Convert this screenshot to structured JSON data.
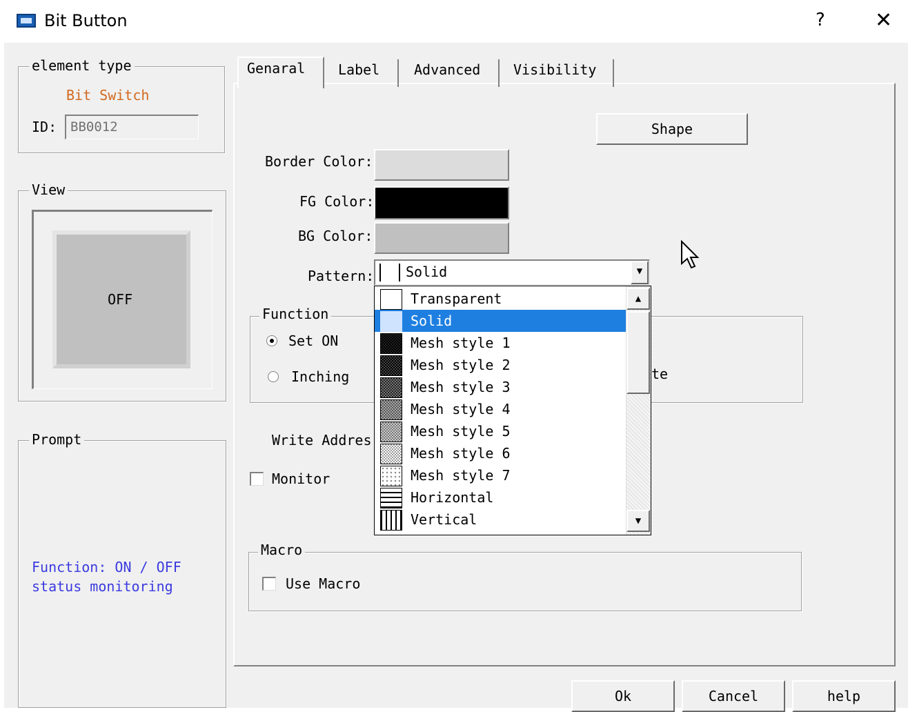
{
  "window": {
    "title": "Bit Button",
    "help_glyph": "?",
    "close_glyph": "✕",
    "icon": "hmi-app-icon"
  },
  "element_type": {
    "legend": "element type",
    "value": "Bit Switch",
    "id_label": "ID:",
    "id_value": "BB0012",
    "value_color": "#d2691e"
  },
  "view": {
    "legend": "View",
    "preview_text": "OFF"
  },
  "prompt": {
    "legend": "Prompt",
    "line1": "Function: ON / OFF",
    "line2": "status monitoring",
    "text_color": "#3a3ae0"
  },
  "tabs": [
    {
      "label": "Genaral",
      "active": true
    },
    {
      "label": "Label",
      "active": false
    },
    {
      "label": "Advanced",
      "active": false
    },
    {
      "label": "Visibility",
      "active": false
    }
  ],
  "general": {
    "shape_button": "Shape",
    "border_color_label": "Border Color:",
    "fg_color_label": "FG Color:",
    "bg_color_label": "BG Color:",
    "pattern_label": "Pattern:",
    "border_color": "#dcdcdc",
    "fg_color": "#000000",
    "bg_color": "#c0c0c0"
  },
  "pattern_combo": {
    "selected": "Solid",
    "items": [
      {
        "label": "Transparent",
        "pattern": "transparent"
      },
      {
        "label": "Solid",
        "pattern": "solid",
        "selected": true
      },
      {
        "label": "Mesh style 1",
        "pattern": "mesh1"
      },
      {
        "label": "Mesh style 2",
        "pattern": "mesh2"
      },
      {
        "label": "Mesh style 3",
        "pattern": "mesh3"
      },
      {
        "label": "Mesh style 4",
        "pattern": "mesh4"
      },
      {
        "label": "Mesh style 5",
        "pattern": "mesh5"
      },
      {
        "label": "Mesh style 6",
        "pattern": "mesh6"
      },
      {
        "label": "Mesh style 7",
        "pattern": "mesh7"
      },
      {
        "label": "Horizontal",
        "pattern": "horizontal"
      },
      {
        "label": "Vertical",
        "pattern": "vertical"
      }
    ]
  },
  "function": {
    "legend": "Function",
    "set_on": "Set ON",
    "inching": "Inching",
    "partial_right": "te",
    "selected": "Set ON"
  },
  "write_address": {
    "label": "Write Addres"
  },
  "monitor": {
    "label": "Monitor",
    "checked": false
  },
  "macro": {
    "legend": "Macro",
    "use_macro": "Use Macro",
    "checked": false
  },
  "footer": {
    "ok": "Ok",
    "cancel": "Cancel",
    "help": "help"
  }
}
